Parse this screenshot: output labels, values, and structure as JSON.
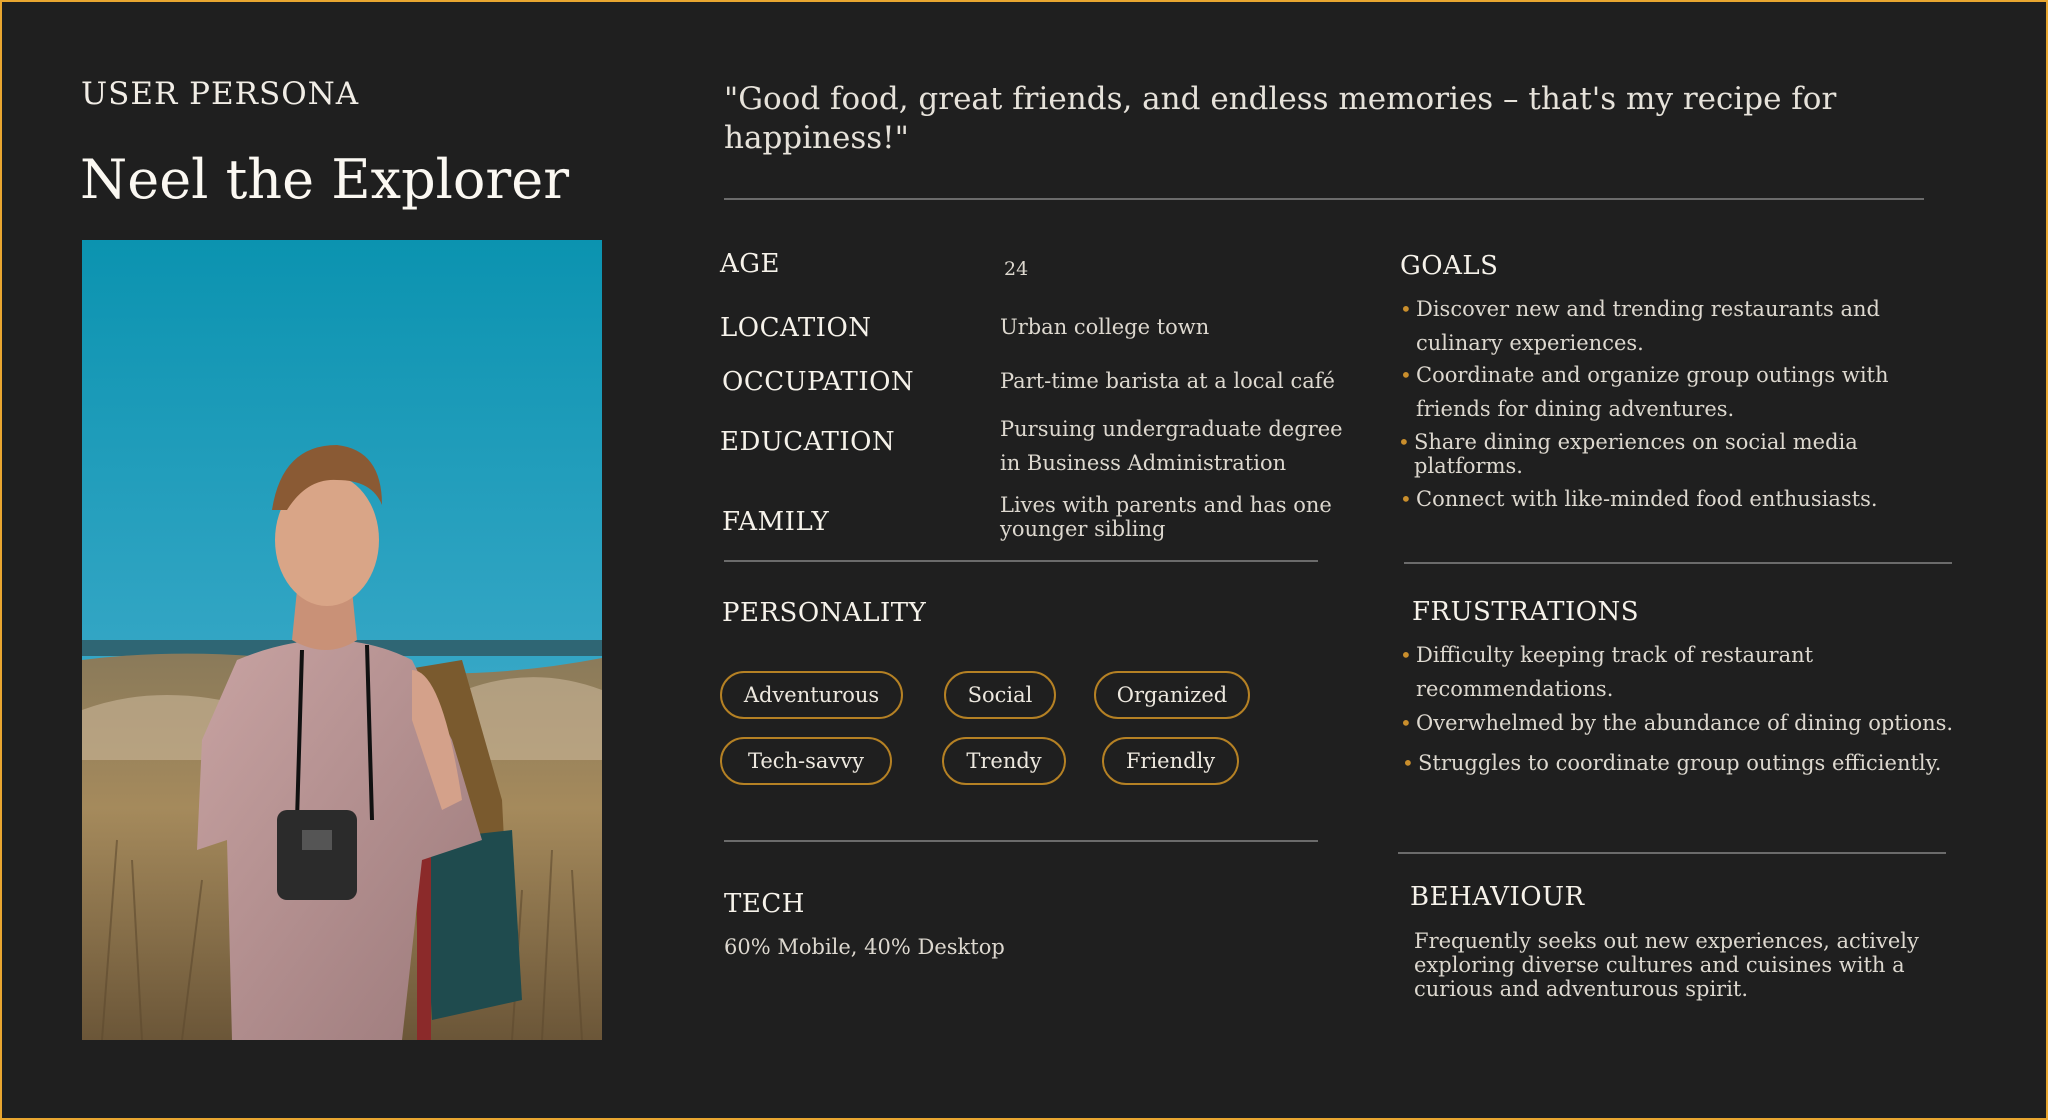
{
  "header": {
    "eyebrow": "USER PERSONA",
    "name": "Neel the Explorer",
    "quote": "\"Good food, great friends, and endless memories – that's my recipe for happiness!\""
  },
  "profile": {
    "age_label": "AGE",
    "age_value": "24",
    "location_label": "LOCATION",
    "location_value": "Urban college town",
    "occupation_label": "OCCUPATION",
    "occupation_value": "Part-time barista at a local café",
    "education_label": "EDUCATION",
    "education_value": "Pursuing undergraduate degree in Business Administration",
    "family_label": "FAMILY",
    "family_value": "Lives with parents and has one younger sibling"
  },
  "personality": {
    "title": "PERSONALITY",
    "traits": [
      "Adventurous",
      "Social",
      "Organized",
      "Tech-savvy",
      "Trendy",
      "Friendly"
    ]
  },
  "tech": {
    "title": "TECH",
    "value": "60% Mobile, 40% Desktop"
  },
  "goals": {
    "title": "GOALS",
    "items": [
      "Discover new and trending restaurants and culinary experiences.",
      "Coordinate and organize group outings with friends for dining adventures.",
      "Share dining experiences on social media platforms.",
      "Connect with like-minded food enthusiasts."
    ]
  },
  "frustrations": {
    "title": "FRUSTRATIONS",
    "items": [
      "Difficulty keeping track of restaurant recommendations.",
      "Overwhelmed by the abundance of dining options.",
      "Struggles to coordinate group outings efficiently."
    ]
  },
  "behaviour": {
    "title": "BEHAVIOUR",
    "text": "Frequently seeks out new experiences, actively exploring diverse cultures and cuisines with a curious and adventurous spirit."
  },
  "colors": {
    "background": "#1f1f1f",
    "accent": "#e8a630",
    "pill_border": "#b58124",
    "bullet": "#c98e2c",
    "divider": "#6b6b6b"
  },
  "icons": {
    "bullet": "bullet-dot-icon"
  }
}
